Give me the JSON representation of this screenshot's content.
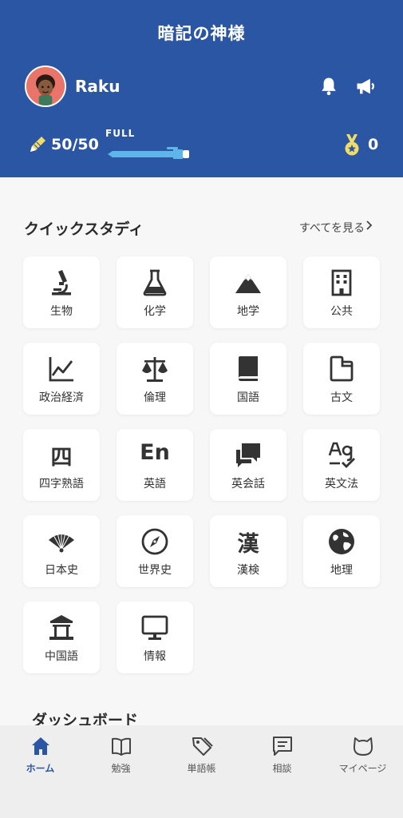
{
  "header": {
    "app_title": "暗記の神様",
    "username": "Raku",
    "stamina": "50/50",
    "stamina_state": "FULL",
    "stamina_fill": 1.0,
    "medal_count": "0",
    "icons": [
      "bell-icon",
      "megaphone-icon",
      "pencil-icon",
      "medal-icon"
    ]
  },
  "quick_study": {
    "title": "クイックスタディ",
    "see_all": "すべてを見る",
    "subjects": [
      {
        "label": "生物",
        "icon": "microscope-icon"
      },
      {
        "label": "化学",
        "icon": "flask-icon"
      },
      {
        "label": "地学",
        "icon": "mountain-icon"
      },
      {
        "label": "公共",
        "icon": "building-icon"
      },
      {
        "label": "政治経済",
        "icon": "line-chart-icon"
      },
      {
        "label": "倫理",
        "icon": "scale-icon"
      },
      {
        "label": "国語",
        "icon": "book-icon"
      },
      {
        "label": "古文",
        "icon": "folder-icon"
      },
      {
        "label": "四字熟語",
        "glyph": "四"
      },
      {
        "label": "英語",
        "glyph": "En"
      },
      {
        "label": "英会話",
        "icon": "chat-icon"
      },
      {
        "label": "英文法",
        "icon": "spellcheck-icon"
      },
      {
        "label": "日本史",
        "icon": "fan-icon"
      },
      {
        "label": "世界史",
        "icon": "compass-icon"
      },
      {
        "label": "漢検",
        "glyph": "漢"
      },
      {
        "label": "地理",
        "icon": "globe-icon"
      },
      {
        "label": "中国語",
        "icon": "temple-icon"
      },
      {
        "label": "情報",
        "icon": "monitor-icon"
      }
    ]
  },
  "dashboard": {
    "title": "ダッシュボード"
  },
  "tabbar": {
    "active": "home",
    "accent": "#2a56a4",
    "tabs": [
      {
        "label": "ホーム",
        "icon": "home-icon"
      },
      {
        "label": "勉強",
        "icon": "open-book-icon"
      },
      {
        "label": "単語帳",
        "icon": "tags-icon"
      },
      {
        "label": "相談",
        "icon": "message-icon"
      },
      {
        "label": "マイページ",
        "icon": "cat-icon"
      }
    ]
  },
  "colors": {
    "header_bg": "#2a56a4",
    "pen_bar": "#5fb4ea",
    "medal": "#f1dc68",
    "pencil": "#f1dc68"
  }
}
